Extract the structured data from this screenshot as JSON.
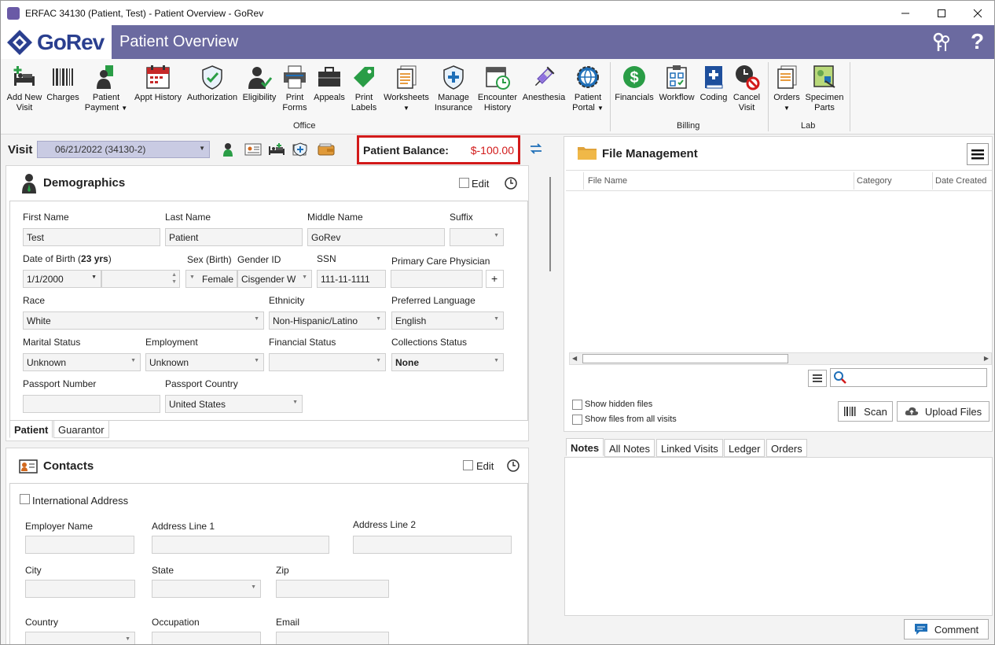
{
  "window": {
    "title": "ERFAC 34130 (Patient, Test) - Patient Overview - GoRev",
    "minimize": "–",
    "maximize": "☐",
    "close": "✕"
  },
  "header": {
    "logo": "GoRev",
    "title": "Patient Overview"
  },
  "ribbon": {
    "office": [
      {
        "label": "Add New\nVisit",
        "icon": "add-visit-icon"
      },
      {
        "label": "Charges",
        "icon": "barcode-icon"
      },
      {
        "label": "Patient\nPayment",
        "icon": "patient-payment-icon"
      },
      {
        "label": "Appt History",
        "icon": "calendar-icon"
      },
      {
        "label": "Authorization",
        "icon": "shield-check-icon"
      },
      {
        "label": "Eligibility",
        "icon": "person-check-icon"
      },
      {
        "label": "Print\nForms",
        "icon": "printer-icon"
      },
      {
        "label": "Appeals",
        "icon": "briefcase-icon"
      },
      {
        "label": "Print\nLabels",
        "icon": "tag-icon"
      },
      {
        "label": "Worksheets",
        "icon": "worksheets-icon"
      },
      {
        "label": "Manage\nInsurance",
        "icon": "insurance-shield-icon"
      },
      {
        "label": "Encounter\nHistory",
        "icon": "encounter-history-icon"
      },
      {
        "label": "Anesthesia",
        "icon": "syringe-icon"
      },
      {
        "label": "Patient\nPortal",
        "icon": "globe-gear-icon"
      }
    ],
    "billing": [
      {
        "label": "Financials",
        "icon": "dollar-icon"
      },
      {
        "label": "Workflow",
        "icon": "workflow-icon"
      },
      {
        "label": "Coding",
        "icon": "book-plus-icon"
      },
      {
        "label": "Cancel\nVisit",
        "icon": "cancel-visit-icon"
      }
    ],
    "lab": [
      {
        "label": "Orders",
        "icon": "orders-icon"
      },
      {
        "label": "Specimen\nParts",
        "icon": "specimen-icon"
      }
    ],
    "group_office": "Office",
    "group_billing": "Billing",
    "group_lab": "Lab"
  },
  "visit": {
    "label": "Visit",
    "selected": "06/21/2022 (34130-2)"
  },
  "balance": {
    "label": "Patient Balance:",
    "value": "$-100.00"
  },
  "demographics": {
    "title": "Demographics",
    "edit": "Edit",
    "first_name_label": "First Name",
    "first_name": "Test",
    "last_name_label": "Last Name",
    "last_name": "Patient",
    "middle_name_label": "Middle Name",
    "middle_name": "GoRev",
    "suffix_label": "Suffix",
    "dob_label": "Date of Birth (",
    "age": "23 yrs",
    "dob_close": ")",
    "dob": "1/1/2000",
    "sex_label": "Sex (Birth)",
    "sex": "Female",
    "gender_label": "Gender ID",
    "gender": "Cisgender W",
    "ssn_label": "SSN",
    "ssn": "111-11-1111",
    "pcp_label": "Primary Care Physician",
    "pcp_add": "+",
    "race_label": "Race",
    "race": "White",
    "ethnicity_label": "Ethnicity",
    "ethnicity": "Non-Hispanic/Latino",
    "language_label": "Preferred Language",
    "language": "English",
    "marital_label": "Marital Status",
    "marital": "Unknown",
    "employment_label": "Employment",
    "employment": "Unknown",
    "financial_label": "Financial Status",
    "collections_label": "Collections Status",
    "collections": "None",
    "passport_label": "Passport Number",
    "passport_country_label": "Passport Country",
    "passport_country": "United States",
    "tab_patient": "Patient",
    "tab_guarantor": "Guarantor"
  },
  "contacts": {
    "title": "Contacts",
    "edit": "Edit",
    "international": "International Address",
    "employer_label": "Employer Name",
    "address1_label": "Address Line 1",
    "address2_label": "Address Line 2",
    "city_label": "City",
    "state_label": "State",
    "zip_label": "Zip",
    "country_label": "Country",
    "occupation_label": "Occupation",
    "email_label": "Email"
  },
  "files": {
    "title": "File Management",
    "col_name": "File Name",
    "col_category": "Category",
    "col_date": "Date Created",
    "show_hidden": "Show hidden files",
    "show_all": "Show files from all visits",
    "scan": "Scan",
    "upload": "Upload Files"
  },
  "notes": {
    "tabs": [
      "Notes",
      "All Notes",
      "Linked Visits",
      "Ledger",
      "Orders"
    ],
    "comment": "Comment"
  }
}
